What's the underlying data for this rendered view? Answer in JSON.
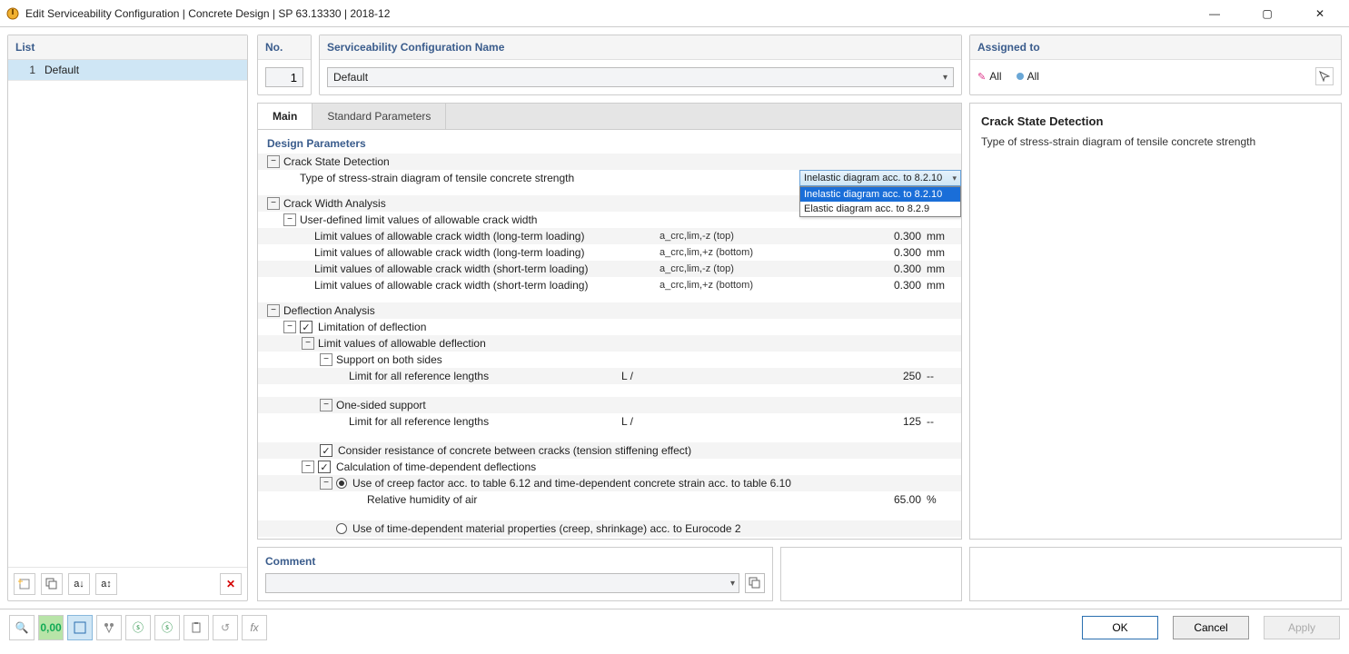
{
  "window": {
    "title": "Edit Serviceability Configuration | Concrete Design | SP 63.13330 | 2018-12"
  },
  "list": {
    "header": "List",
    "items": [
      {
        "num": "1",
        "name": "Default"
      }
    ]
  },
  "no": {
    "header": "No.",
    "value": "1"
  },
  "config_name": {
    "header": "Serviceability Configuration Name",
    "value": "Default"
  },
  "assigned": {
    "header": "Assigned to",
    "labels": {
      "a": "All",
      "b": "All"
    }
  },
  "tabs": {
    "main": "Main",
    "std": "Standard Parameters"
  },
  "design_params": {
    "header": "Design Parameters",
    "crack_state": {
      "title": "Crack State Detection",
      "type_label": "Type of stress-strain diagram of tensile concrete strength",
      "selected": "Inelastic diagram acc. to 8.2.10",
      "options": [
        "Inelastic diagram acc. to 8.2.10",
        "Elastic diagram acc. to 8.2.9"
      ]
    },
    "crack_width": {
      "title": "Crack Width Analysis",
      "subtitle": "User-defined limit values of allowable crack width",
      "rows": [
        {
          "label": "Limit values of allowable crack width (long-term loading)",
          "sym": "a_crc,lim,-z (top)",
          "val": "0.300",
          "unit": "mm"
        },
        {
          "label": "Limit values of allowable crack width (long-term loading)",
          "sym": "a_crc,lim,+z (bottom)",
          "val": "0.300",
          "unit": "mm"
        },
        {
          "label": "Limit values of allowable crack width (short-term loading)",
          "sym": "a_crc,lim,-z (top)",
          "val": "0.300",
          "unit": "mm"
        },
        {
          "label": "Limit values of allowable crack width (short-term loading)",
          "sym": "a_crc,lim,+z (bottom)",
          "val": "0.300",
          "unit": "mm"
        }
      ]
    },
    "deflection": {
      "title": "Deflection Analysis",
      "limitation": "Limitation of deflection",
      "lvad": "Limit values of allowable deflection",
      "both": {
        "title": "Support on both sides",
        "row_label": "Limit for all reference lengths",
        "sym": "L /",
        "val": "250",
        "unit": "--"
      },
      "one": {
        "title": "One-sided support",
        "row_label": "Limit for all reference lengths",
        "sym": "L /",
        "val": "125",
        "unit": "--"
      },
      "tension": "Consider resistance of concrete between cracks (tension stiffening effect)",
      "timedep": "Calculation of time-dependent deflections",
      "creep": "Use of creep factor acc. to table 6.12 and time-dependent concrete strain acc. to table 6.10",
      "rh": {
        "label": "Relative humidity of air",
        "val": "65.00",
        "unit": "%"
      },
      "euro": "Use of time-dependent material properties (creep, shrinkage) acc. to Eurocode 2"
    }
  },
  "info": {
    "title": "Crack State Detection",
    "text": "Type of stress-strain diagram of tensile concrete strength"
  },
  "comment": {
    "header": "Comment"
  },
  "buttons": {
    "ok": "OK",
    "cancel": "Cancel",
    "apply": "Apply"
  }
}
